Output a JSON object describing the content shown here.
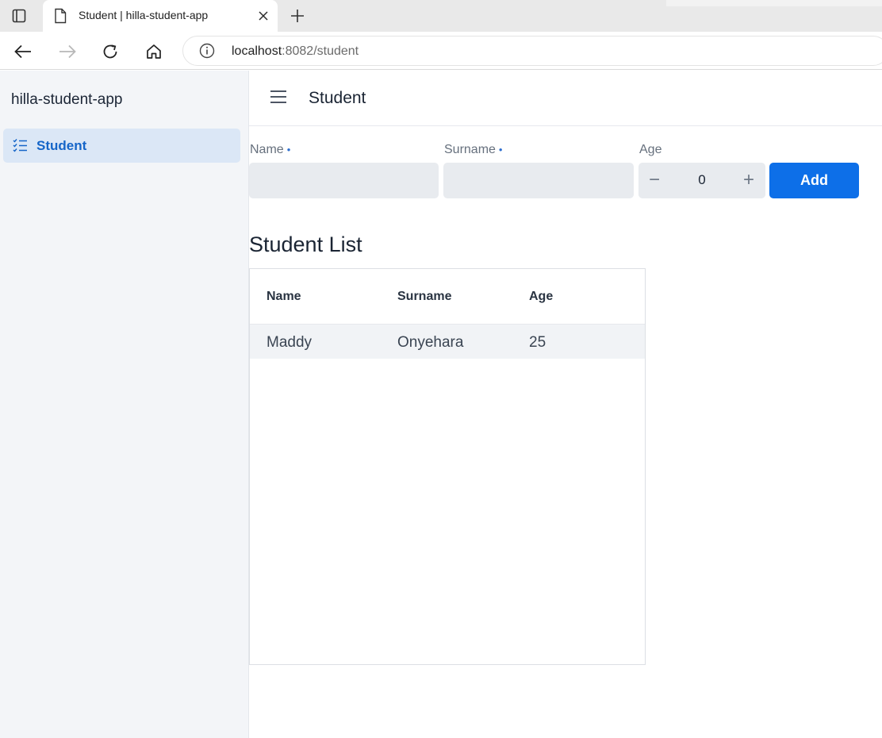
{
  "browser": {
    "tab_title": "Student | hilla-student-app",
    "url_host": "localhost",
    "url_rest": ":8082/student"
  },
  "sidebar": {
    "app_name": "hilla-student-app",
    "items": [
      {
        "label": "Student",
        "icon": "checklist-icon",
        "active": true
      }
    ]
  },
  "header": {
    "title": "Student"
  },
  "form": {
    "name_label": "Name",
    "surname_label": "Surname",
    "age_label": "Age",
    "name_value": "",
    "surname_value": "",
    "age_value": "0",
    "add_label": "Add",
    "minus_label": "−",
    "plus_label": "+",
    "required_marker": "•"
  },
  "list": {
    "title": "Student List",
    "columns": [
      "Name",
      "Surname",
      "Age"
    ],
    "rows": [
      [
        "Maddy",
        "Onyehara",
        "25"
      ]
    ]
  },
  "colors": {
    "accent": "#0d6fe8",
    "nav_active_bg": "#dbe7f6",
    "nav_active_text": "#1565c8",
    "sidebar_bg": "#f3f5f8",
    "input_bg": "#e8ebef"
  }
}
